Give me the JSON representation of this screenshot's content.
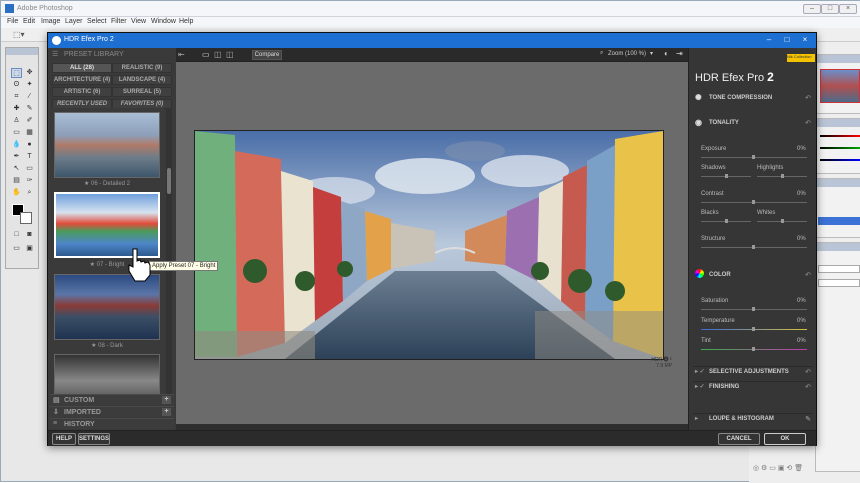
{
  "photoshop": {
    "title": "Adobe Photoshop",
    "menu": [
      "File",
      "Edit",
      "Image",
      "Layer",
      "Select",
      "Filter",
      "View",
      "Window",
      "Help"
    ]
  },
  "plugin": {
    "title": "HDR Efex Pro 2",
    "preset_library_label": "PRESET LIBRARY",
    "categories": [
      {
        "label": "ALL (28)",
        "active": true
      },
      {
        "label": "REALISTIC (9)"
      },
      {
        "label": "ARCHITECTURE (4)"
      },
      {
        "label": "LANDSCAPE (4)"
      },
      {
        "label": "ARTISTIC (6)"
      },
      {
        "label": "SURREAL (5)"
      },
      {
        "label": "RECENTLY USED"
      },
      {
        "label": "FAVORITES (0)"
      }
    ],
    "presets": [
      {
        "label": "★ 06 - Detailed 2"
      },
      {
        "label": "★ 07 - Bright"
      },
      {
        "label": "★ 08 - Dark"
      }
    ],
    "sections": [
      {
        "label": "CUSTOM"
      },
      {
        "label": "IMPORTED"
      },
      {
        "label": "HISTORY"
      }
    ],
    "buttons": {
      "help": "HELP",
      "settings": "SETTINGS",
      "cancel": "CANCEL",
      "ok": "OK"
    },
    "toolbar": {
      "compare": "Compare",
      "zoom": "Zoom (100 %)"
    },
    "tooltip": "Apply Preset 07 - Bright",
    "badge": {
      "line1": "HDR 🅐 ᴱ",
      "line2": "7.9 MP"
    },
    "right": {
      "title_prefix": "HDR Efex Pro ",
      "title_num": "2",
      "nik_badge": "Nik Collection",
      "tone_compression": "TONE COMPRESSION",
      "tonality": "TONALITY",
      "exposure": {
        "label": "Exposure",
        "value": "0%"
      },
      "shadows": "Shadows",
      "highlights": "Highlights",
      "contrast": {
        "label": "Contrast",
        "value": "0%"
      },
      "blacks": "Blacks",
      "whites": "Whites",
      "structure": {
        "label": "Structure",
        "value": "0%"
      },
      "color": "COLOR",
      "saturation": {
        "label": "Saturation",
        "value": "0%"
      },
      "temperature": {
        "label": "Temperature",
        "value": "0%"
      },
      "tint": {
        "label": "Tint",
        "value": "0%"
      },
      "selective": "SELECTIVE ADJUSTMENTS",
      "finishing": "FINISHING",
      "loupe": "LOUPE & HISTOGRAM"
    }
  }
}
